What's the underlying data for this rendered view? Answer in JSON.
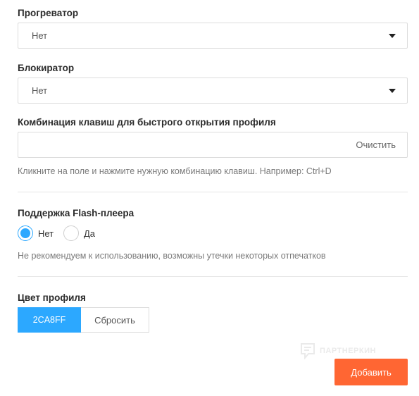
{
  "colors": {
    "accent": "#2CA8FF",
    "primary_button": "#FF6633"
  },
  "progrevator": {
    "label": "Прогреватор",
    "value": "Нет"
  },
  "blocker": {
    "label": "Блокиратор",
    "value": "Нет"
  },
  "hotkey": {
    "label": "Комбинация клавиш для быстрого открытия профиля",
    "value": "",
    "clear_label": "Очистить",
    "hint": "Кликните на поле и нажмите нужную комбинацию клавиш. Например: Ctrl+D"
  },
  "flash": {
    "label": "Поддержка Flash-плеера",
    "options": [
      {
        "label": "Нет",
        "selected": true
      },
      {
        "label": "Да",
        "selected": false
      }
    ],
    "hint": "Не рекомендуем к использованию, возможны утечки некоторых отпечатков"
  },
  "profile_color": {
    "label": "Цвет профиля",
    "value": "2CA8FF",
    "reset_label": "Сбросить"
  },
  "watermark": {
    "text": "ПАРТНЕРКИН",
    "icon": "chat-bubble-icon"
  },
  "add_button": {
    "label": "Добавить"
  }
}
